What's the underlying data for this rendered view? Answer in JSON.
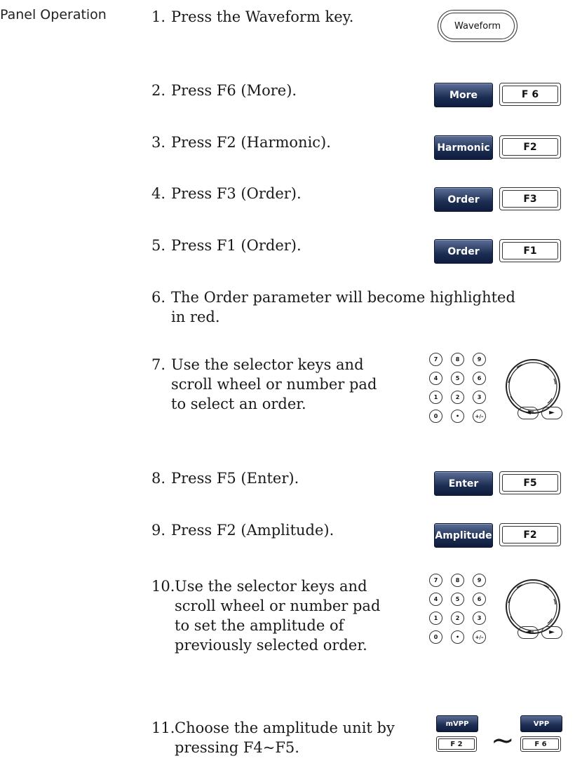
{
  "section_label": "Panel Operation",
  "steps": [
    {
      "num": "1.",
      "text": "Press the Waveform key."
    },
    {
      "num": "2.",
      "text": "Press F6 (More)."
    },
    {
      "num": "3.",
      "text": "Press F2 (Harmonic)."
    },
    {
      "num": "4.",
      "text": "Press F3 (Order)."
    },
    {
      "num": "5.",
      "text": "Press F1 (Order)."
    },
    {
      "num": "6.",
      "line1": "The Order parameter will become highlighted",
      "line2": "in red."
    },
    {
      "num": "7.",
      "line1": "Use the selector keys and",
      "line2": "scroll wheel or number pad",
      "line3": "to select an order."
    },
    {
      "num": "8.",
      "text": "Press F5 (Enter)."
    },
    {
      "num": "9.",
      "text": "Press F2 (Amplitude)."
    },
    {
      "num": "10.",
      "line1": "Use the selector keys and",
      "line2": "scroll wheel or number pad",
      "line3": "to set the amplitude of",
      "line4": "previously selected order."
    },
    {
      "num": "11.",
      "line1": "Choose the amplitude unit by",
      "line2": "pressing F4~F5."
    }
  ],
  "keys": {
    "waveform": "Waveform",
    "more": "More",
    "f6": "F 6",
    "harmonic": "Harmonic",
    "f2": "F2",
    "order": "Order",
    "f3": "F3",
    "f1": "F1",
    "enter": "Enter",
    "f5": "F5",
    "amplitude": "Amplitude",
    "mvpp": "mVPP",
    "vpp": "VPP",
    "f2_small": "F 2",
    "f6_small": "F 6",
    "tilde": "~"
  },
  "numpad": [
    "7",
    "8",
    "9",
    "4",
    "5",
    "6",
    "1",
    "2",
    "3",
    "0",
    "•",
    "+/–"
  ],
  "arrows": {
    "left": "◄",
    "right": "►"
  },
  "icons": {
    "scroll_wheel": "scroll-wheel-icon",
    "left_arrow": "left-arrow-icon",
    "right_arrow": "right-arrow-icon"
  }
}
